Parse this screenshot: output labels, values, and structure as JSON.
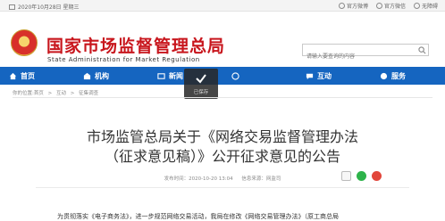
{
  "topbar": {
    "date": "2020年10月28日 星期三",
    "links": [
      "官方微博",
      "官方微信",
      "无障碍"
    ]
  },
  "header": {
    "title": "国家市场监督管理总局",
    "subtitle": "State Administration for Market Regulation",
    "search_placeholder": "请输入要查询的内容"
  },
  "nav": {
    "items": [
      {
        "label": "首页",
        "icon": "home-icon"
      },
      {
        "label": "机构",
        "icon": "building-icon"
      },
      {
        "label": "新闻",
        "icon": "news-icon"
      },
      {
        "label": "",
        "icon": "info-icon"
      },
      {
        "label": "互动",
        "icon": "chat-icon"
      },
      {
        "label": "服务",
        "icon": "service-icon"
      }
    ]
  },
  "toast": {
    "label": "已保存"
  },
  "breadcrumb": [
    "你的位置:首页",
    ">",
    "互动",
    ">",
    "征集调查"
  ],
  "article": {
    "title_line1": "市场监管总局关于《网络交易监督管理办法",
    "title_line2": "（征求意见稿）》公开征求意见的公告",
    "published": "发布时间：2020-10-20 13:04",
    "source": "信息来源：网监司",
    "body_start": "为贯彻落实《电子商务法》，进一步规范网络交易活动，我局在修改《网络交易管理办法》（原工商总局"
  },
  "colors": {
    "brand_red": "#c8161d",
    "nav_blue": "#1565c0"
  }
}
